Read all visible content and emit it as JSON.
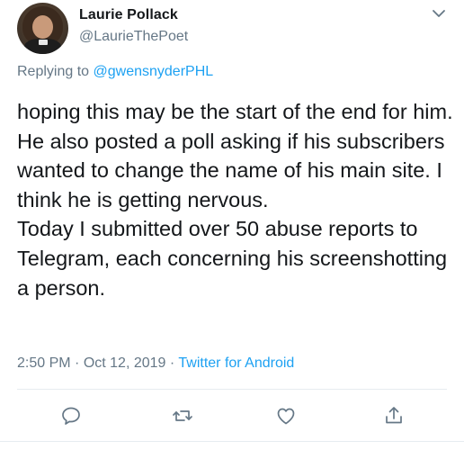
{
  "author": {
    "display_name": "Laurie Pollack",
    "handle": "@LaurieThePoet"
  },
  "reply": {
    "prefix": "Replying to ",
    "mention": "@gwensnyderPHL"
  },
  "tweet": {
    "lines": [
      "hoping this may be the start of the end for him.  He also posted a poll asking if his subscribers wanted to change the name of his main site.  I think he is getting nervous.",
      "Today I submitted over 50 abuse reports to Telegram, each concerning his screenshotting a person."
    ]
  },
  "meta": {
    "time": "2:50 PM",
    "separator": " · ",
    "date": "Oct 12, 2019",
    "source": "Twitter for Android"
  },
  "icons": {
    "reply": "speech-bubble-icon",
    "retweet": "retweet-icon",
    "like": "heart-icon",
    "share": "share-icon",
    "more": "chevron-down-icon"
  },
  "colors": {
    "text": "#14171a",
    "secondary": "#657786",
    "accent": "#1da1f2",
    "divider": "#e6ecf0"
  }
}
